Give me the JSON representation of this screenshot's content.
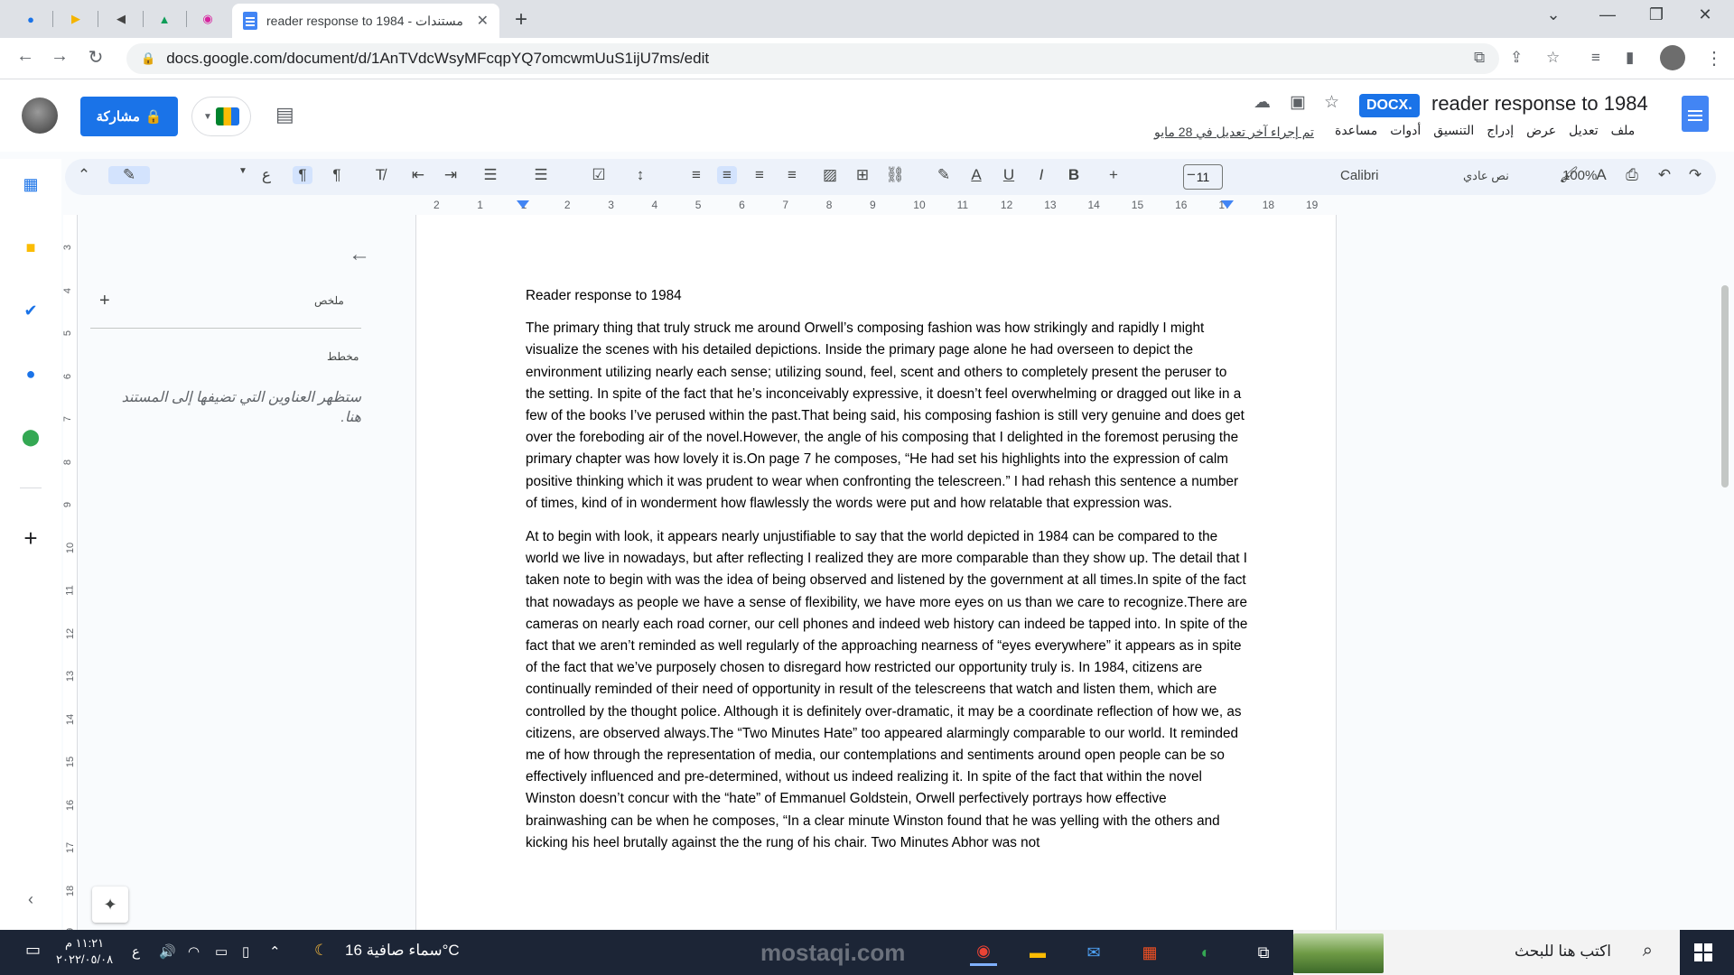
{
  "browser": {
    "pinned_tabs": [
      {
        "name": "chrome-extension-icon",
        "glyph": "●",
        "color": "#1a73e8"
      },
      {
        "name": "media-player-icon",
        "glyph": "▶",
        "color": "#f4b400"
      },
      {
        "name": "audio-icon",
        "glyph": "◀",
        "color": "#444"
      },
      {
        "name": "google-drive-icon",
        "glyph": "▲",
        "color": "#0f9d58"
      },
      {
        "name": "instagram-icon",
        "glyph": "◉",
        "color": "#d6249f"
      }
    ],
    "active_tab_title": "reader response to 1984 - مستندات",
    "new_tab_label": "+",
    "url": "docs.google.com/document/d/1AnTVdcWsyMFcqpYQ7omcwmUuS1ijU7ms/edit",
    "window_controls": {
      "chevron": "⌄",
      "minimize": "—",
      "restore": "❐",
      "close": "✕"
    }
  },
  "docs": {
    "share_label": "مشاركة",
    "doc_badge": "DOCX.",
    "doc_title": "reader response to 1984",
    "last_edit": "تم إجراء آخر تعديل في 28 مايو",
    "menus": [
      "ملف",
      "تعديل",
      "عرض",
      "إدراج",
      "التنسيق",
      "أدوات",
      "مساعدة"
    ]
  },
  "format_toolbar": {
    "font": "Calibri",
    "font_size": "11",
    "style": "نص عادي",
    "zoom": "100%"
  },
  "ruler": {
    "numbers": [
      "2",
      "1",
      "1",
      "2",
      "3",
      "4",
      "5",
      "6",
      "7",
      "8",
      "9",
      "10",
      "11",
      "12",
      "13",
      "14",
      "15",
      "16",
      "17",
      "18",
      "19"
    ],
    "vertical_numbers": [
      "3",
      "4",
      "5",
      "6",
      "7",
      "8",
      "9",
      "10",
      "11",
      "12",
      "13",
      "14",
      "15",
      "16",
      "17",
      "18",
      "19"
    ]
  },
  "outline": {
    "summary_label": "ملخص",
    "outline_label": "مخطط",
    "hint": "ستظهر العناوين التي تضيفها إلى المستند هنا."
  },
  "document": {
    "title": "Reader response to 1984",
    "paragraphs": [
      "The primary thing that truly struck me around Orwell’s composing fashion was how strikingly and rapidly I might visualize the scenes with his detailed depictions. Inside the primary page alone he had overseen to depict the environment utilizing nearly each sense; utilizing sound, feel, scent and others to completely present the peruser to the setting. In spite of the fact that he’s inconceivably expressive, it doesn’t feel overwhelming or dragged out like in a few of the books I’ve perused within the past.That being said, his composing fashion is still very genuine and does get over the foreboding air of the novel.However, the angle of his composing that I delighted in the foremost perusing the primary chapter was how lovely it is.On page 7 he composes, “He had set his highlights into the expression of calm positive thinking which it was prudent to wear when confronting the telescreen.” I had rehash this sentence a number of times, kind of in wonderment how flawlessly the words were put and how relatable that expression was.",
      "At to begin with look, it appears nearly unjustifiable to say that the world depicted in 1984 can be compared to the world we live in nowadays, but after reflecting I realized they are more comparable than they show up. The detail that I taken note to begin with was the idea of being observed and listened by the government at all times.In spite of the fact that nowadays as people we have a sense of flexibility, we have more eyes on us than we care to recognize.There are cameras on nearly each road corner, our cell phones and indeed web history can indeed be tapped into. In spite of the fact that we aren’t reminded as well regularly of the approaching nearness of “eyes everywhere” it appears as in spite of the fact that we’ve purposely chosen to disregard how restricted our opportunity truly is.  In 1984, citizens are continually reminded of their need of opportunity in result of the telescreens that watch and listen them, which are controlled by the thought police. Although it is definitely over-dramatic, it may be a coordinate reflection of how we, as citizens, are observed always.The “Two Minutes Hate” too appeared alarmingly comparable to our world. It reminded me of how through the representation of media, our contemplations and sentiments around open people can be so effectively influenced and pre-determined, without us indeed realizing it.  In spite of the fact that within the novel Winston doesn’t concur with the “hate” of Emmanuel Goldstein, Orwell perfectively portrays how effective brainwashing can be when he composes, “In a clear minute Winston found that he was yelling with the others and kicking his heel brutally against the the rung of his chair. Two Minutes Abhor was not"
    ]
  },
  "taskbar": {
    "search_placeholder": "اكتب هنا للبحث",
    "weather": "سماء صافية  16°C",
    "lang": "ع",
    "time": "١١:٢١ م",
    "date": "٢٠٢٢/٠٥/٠٨",
    "watermark": "mostaqi.com"
  },
  "colors": {
    "accent": "#1a73e8",
    "taskbar": "#1c2536"
  }
}
